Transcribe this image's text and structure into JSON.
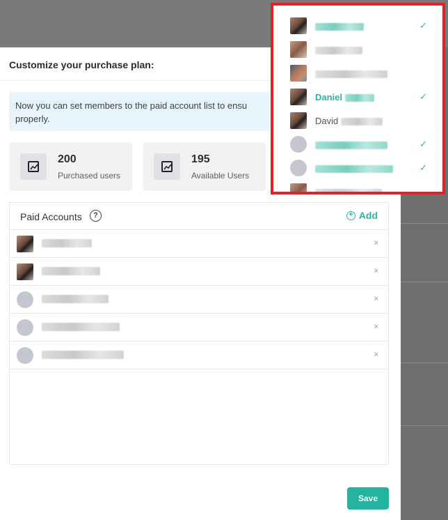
{
  "drawer": {
    "title": "Customize your purchase plan:",
    "notice": "Now you can set members to the paid account list to ensu properly."
  },
  "stats": [
    {
      "value": "200",
      "label": "Purchased users",
      "icon": "chart-icon"
    },
    {
      "value": "195",
      "label": "Available Users",
      "icon": "chart-icon"
    }
  ],
  "paid_accounts": {
    "title": "Paid Accounts",
    "add_label": "Add",
    "rows": [
      {
        "avatar": "photo",
        "remove": "×"
      },
      {
        "avatar": "photo",
        "remove": "×"
      },
      {
        "avatar": "placeholder",
        "remove": "×"
      },
      {
        "avatar": "placeholder",
        "remove": "×"
      },
      {
        "avatar": "placeholder",
        "remove": "×"
      }
    ]
  },
  "save_label": "Save",
  "dropdown": {
    "items": [
      {
        "name": "",
        "selected": true,
        "avatar": "photo"
      },
      {
        "name": "",
        "selected": false,
        "avatar": "photo2"
      },
      {
        "name": "",
        "selected": false,
        "avatar": "photo3"
      },
      {
        "name": "Daniel",
        "selected": true,
        "avatar": "photo"
      },
      {
        "name": "David",
        "selected": false,
        "avatar": "photo"
      },
      {
        "name": "",
        "selected": true,
        "avatar": "placeholder"
      },
      {
        "name": "",
        "selected": true,
        "avatar": "placeholder"
      },
      {
        "name": "",
        "selected": false,
        "avatar": "photo2"
      }
    ],
    "check_glyph": "✓",
    "highlight_color": "#e0222b"
  },
  "colors": {
    "accent": "#23b39e",
    "notice_bg": "#e7f4fc"
  }
}
